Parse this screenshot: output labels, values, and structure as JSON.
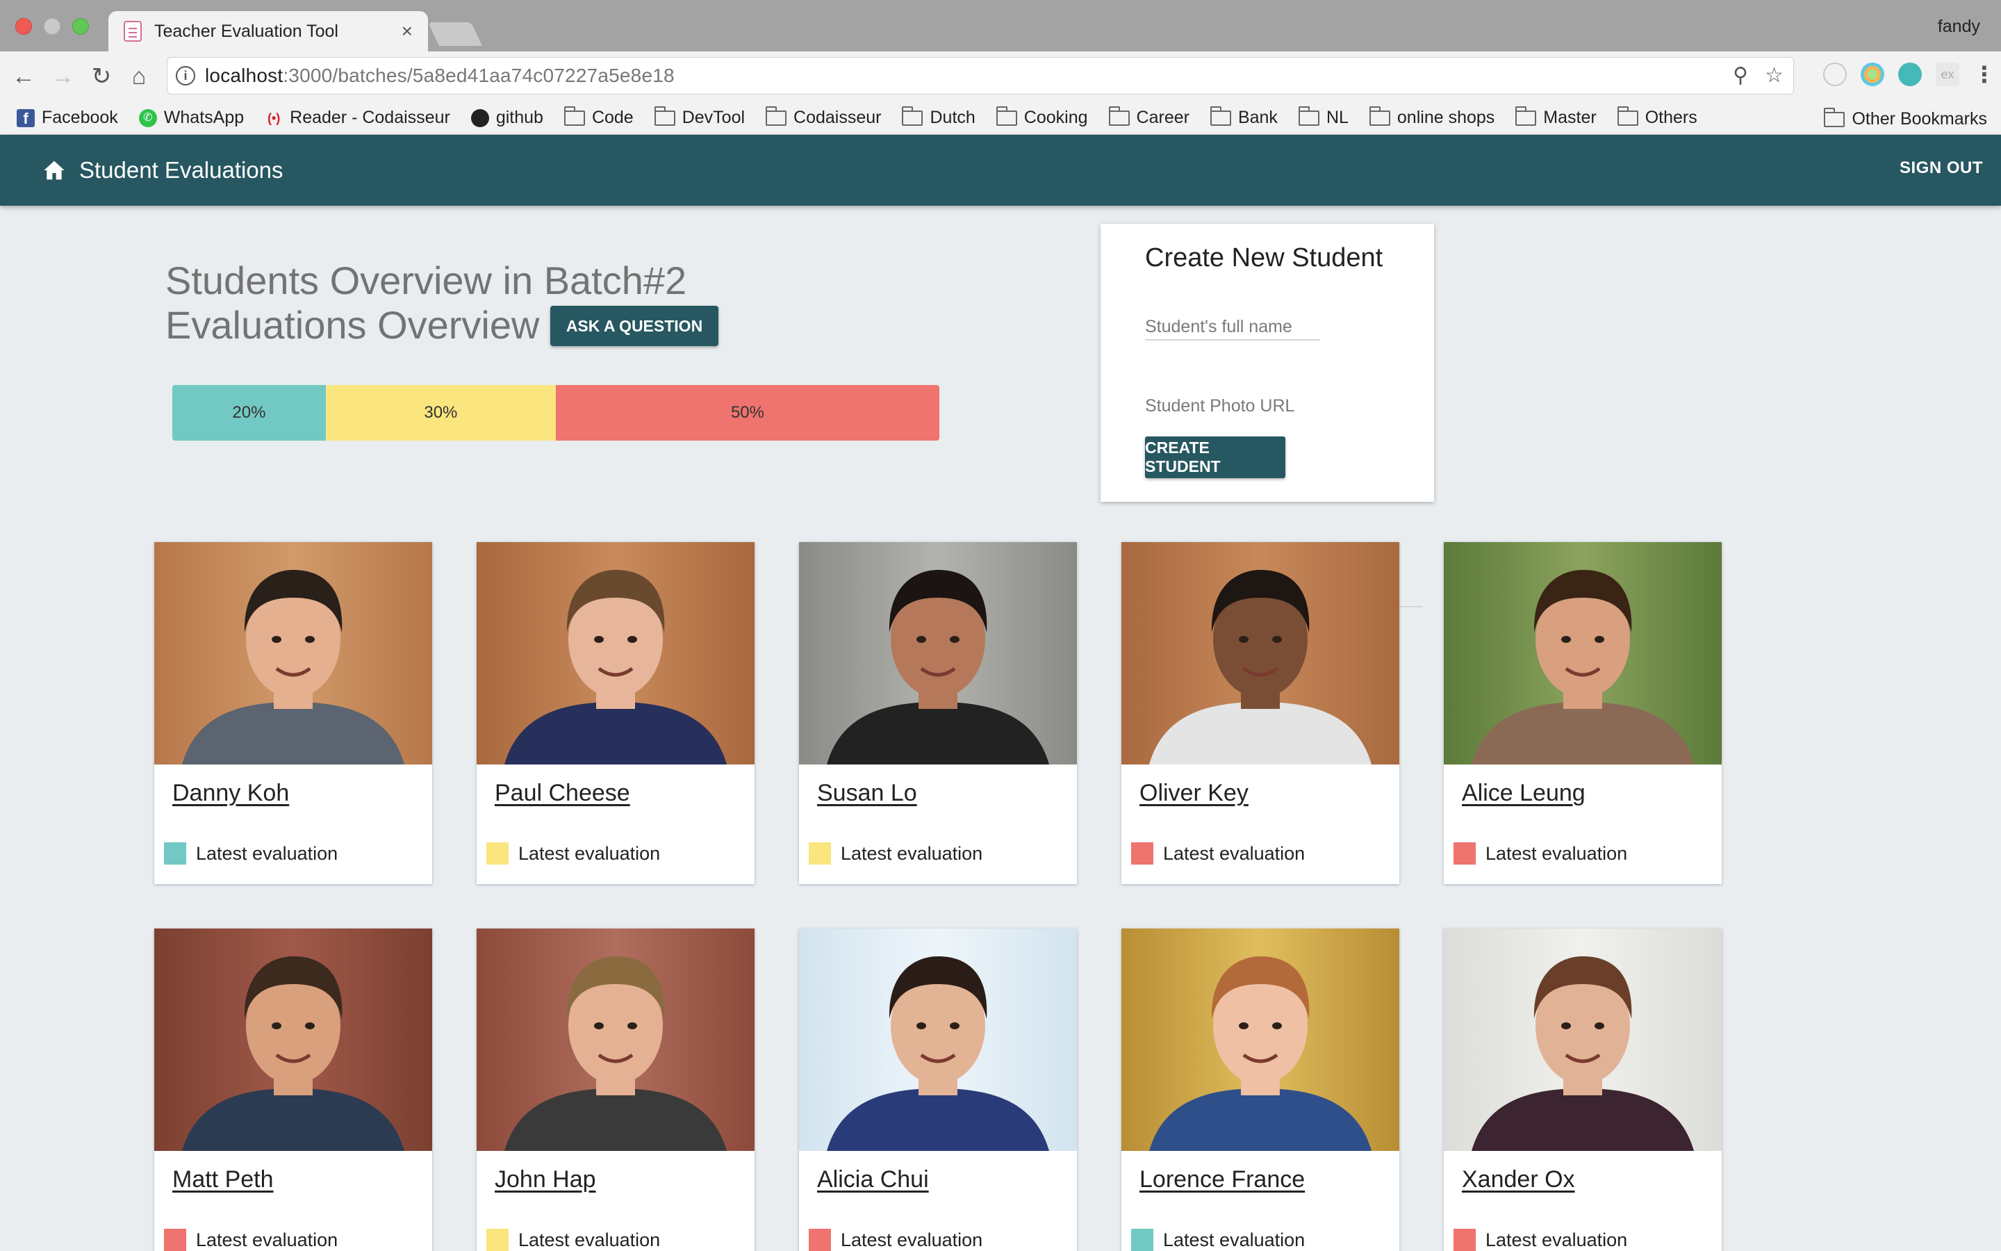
{
  "browser": {
    "tab_title": "Teacher Evaluation Tool",
    "tab_close": "×",
    "profile": "fandy",
    "url_host": "localhost",
    "url_path": ":3000/batches/5a8ed41aa74c07227a5e8e18",
    "bookmarks": [
      {
        "label": "Facebook",
        "icon": "facebook-icon"
      },
      {
        "label": "WhatsApp",
        "icon": "whatsapp-icon"
      },
      {
        "label": "Reader - Codaisseur",
        "icon": "reader-icon"
      },
      {
        "label": "github",
        "icon": "github-icon"
      },
      {
        "label": "Code",
        "icon": "folder-icon"
      },
      {
        "label": "DevTool",
        "icon": "folder-icon"
      },
      {
        "label": "Codaisseur",
        "icon": "folder-icon"
      },
      {
        "label": "Dutch",
        "icon": "folder-icon"
      },
      {
        "label": "Cooking",
        "icon": "folder-icon"
      },
      {
        "label": "Career",
        "icon": "folder-icon"
      },
      {
        "label": "Bank",
        "icon": "folder-icon"
      },
      {
        "label": "NL",
        "icon": "folder-icon"
      },
      {
        "label": "online shops",
        "icon": "folder-icon"
      },
      {
        "label": "Master",
        "icon": "folder-icon"
      },
      {
        "label": "Others",
        "icon": "folder-icon"
      }
    ],
    "other_bookmarks": "Other Bookmarks"
  },
  "appbar": {
    "title": "Student Evaluations",
    "sign_out": "SIGN OUT"
  },
  "overview": {
    "title_line1": "Students Overview in Batch#2",
    "title_line2": "Evaluations Overview",
    "ask_button": "ASK A QUESTION",
    "distribution": [
      {
        "label": "20%",
        "value": 20,
        "color": "#72c9c3"
      },
      {
        "label": "30%",
        "value": 30,
        "color": "#fae57f"
      },
      {
        "label": "50%",
        "value": 50,
        "color": "#ef736e"
      }
    ]
  },
  "create_student": {
    "title": "Create New Student",
    "name_placeholder": "Student's full name",
    "photo_placeholder": "Student Photo URL",
    "button": "CREATE STUDENT"
  },
  "students": [
    {
      "name": "Danny Koh",
      "latest_label": "Latest evaluation",
      "latest_color": "#72c9c3"
    },
    {
      "name": "Paul Cheese",
      "latest_label": "Latest evaluation",
      "latest_color": "#fae57f"
    },
    {
      "name": "Susan Lo",
      "latest_label": "Latest evaluation",
      "latest_color": "#fae57f"
    },
    {
      "name": "Oliver Key",
      "latest_label": "Latest evaluation",
      "latest_color": "#ef736e"
    },
    {
      "name": "Alice Leung",
      "latest_label": "Latest evaluation",
      "latest_color": "#ef736e"
    },
    {
      "name": "Matt Peth",
      "latest_label": "Latest evaluation",
      "latest_color": "#ef736e"
    },
    {
      "name": "John Hap",
      "latest_label": "Latest evaluation",
      "latest_color": "#fae57f"
    },
    {
      "name": "Alicia Chui",
      "latest_label": "Latest evaluation",
      "latest_color": "#ef736e"
    },
    {
      "name": "Lorence France",
      "latest_label": "Latest evaluation",
      "latest_color": "#72c9c3"
    },
    {
      "name": "Xander Ox",
      "latest_label": "Latest evaluation",
      "latest_color": "#ef736e"
    }
  ]
}
